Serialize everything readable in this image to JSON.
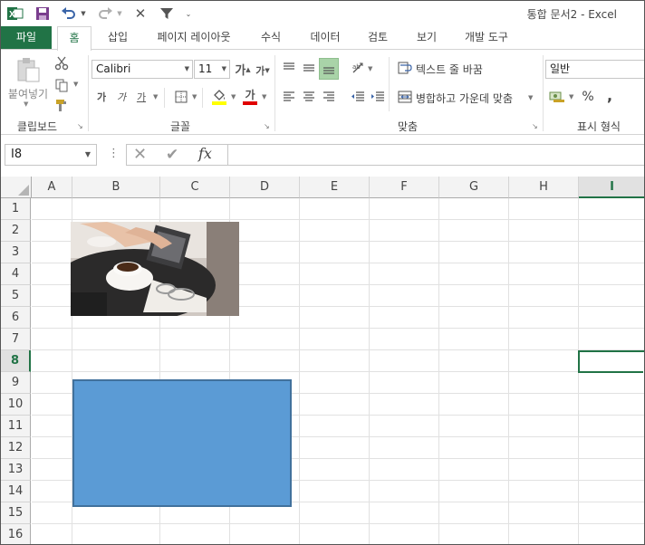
{
  "window": {
    "title": "통합 문서2 - Excel"
  },
  "quick_access": {
    "app_icon": "excel-icon",
    "save_icon": "save-icon",
    "undo_icon": "undo-icon",
    "redo_icon": "redo-icon",
    "close_icon": "x-icon",
    "filter_icon": "filter-icon",
    "customize_icon": "customize-icon"
  },
  "tabs": [
    {
      "label": "파일"
    },
    {
      "label": "홈"
    },
    {
      "label": "삽입"
    },
    {
      "label": "페이지 레이아웃"
    },
    {
      "label": "수식"
    },
    {
      "label": "데이터"
    },
    {
      "label": "검토"
    },
    {
      "label": "보기"
    },
    {
      "label": "개발 도구"
    }
  ],
  "ribbon": {
    "clipboard": {
      "label": "클립보드",
      "paste_label": "붙여넣기"
    },
    "font": {
      "label": "글꼴",
      "font_name": "Calibri",
      "font_size": "11",
      "grow_label": "가",
      "shrink_label": "가",
      "bold_label": "가",
      "italic_label": "가",
      "underline_label": "가",
      "font_color_label": "가",
      "accent_fill": "#ffff00",
      "accent_font": "#e00000"
    },
    "alignment": {
      "label": "맞춤",
      "wrap_text": "텍스트 줄 바꿈",
      "merge_center": "병합하고 가운데 맞춤"
    },
    "number": {
      "label": "표시 형식",
      "format": "일반",
      "percent": "%",
      "comma": ","
    }
  },
  "formula_bar": {
    "name_box": "I8",
    "cancel": "✕",
    "enter": "✔",
    "fx": "fx",
    "value": ""
  },
  "grid": {
    "columns": [
      "A",
      "B",
      "C",
      "D",
      "E",
      "F",
      "G",
      "H",
      "I"
    ],
    "rows": [
      "1",
      "2",
      "3",
      "4",
      "5",
      "6",
      "7",
      "8",
      "9",
      "10",
      "11",
      "12",
      "13",
      "14",
      "15",
      "16"
    ],
    "selected_column": "I",
    "selected_row": "8",
    "shape_fill": "#5b9bd5",
    "shape_border": "#41719c"
  }
}
